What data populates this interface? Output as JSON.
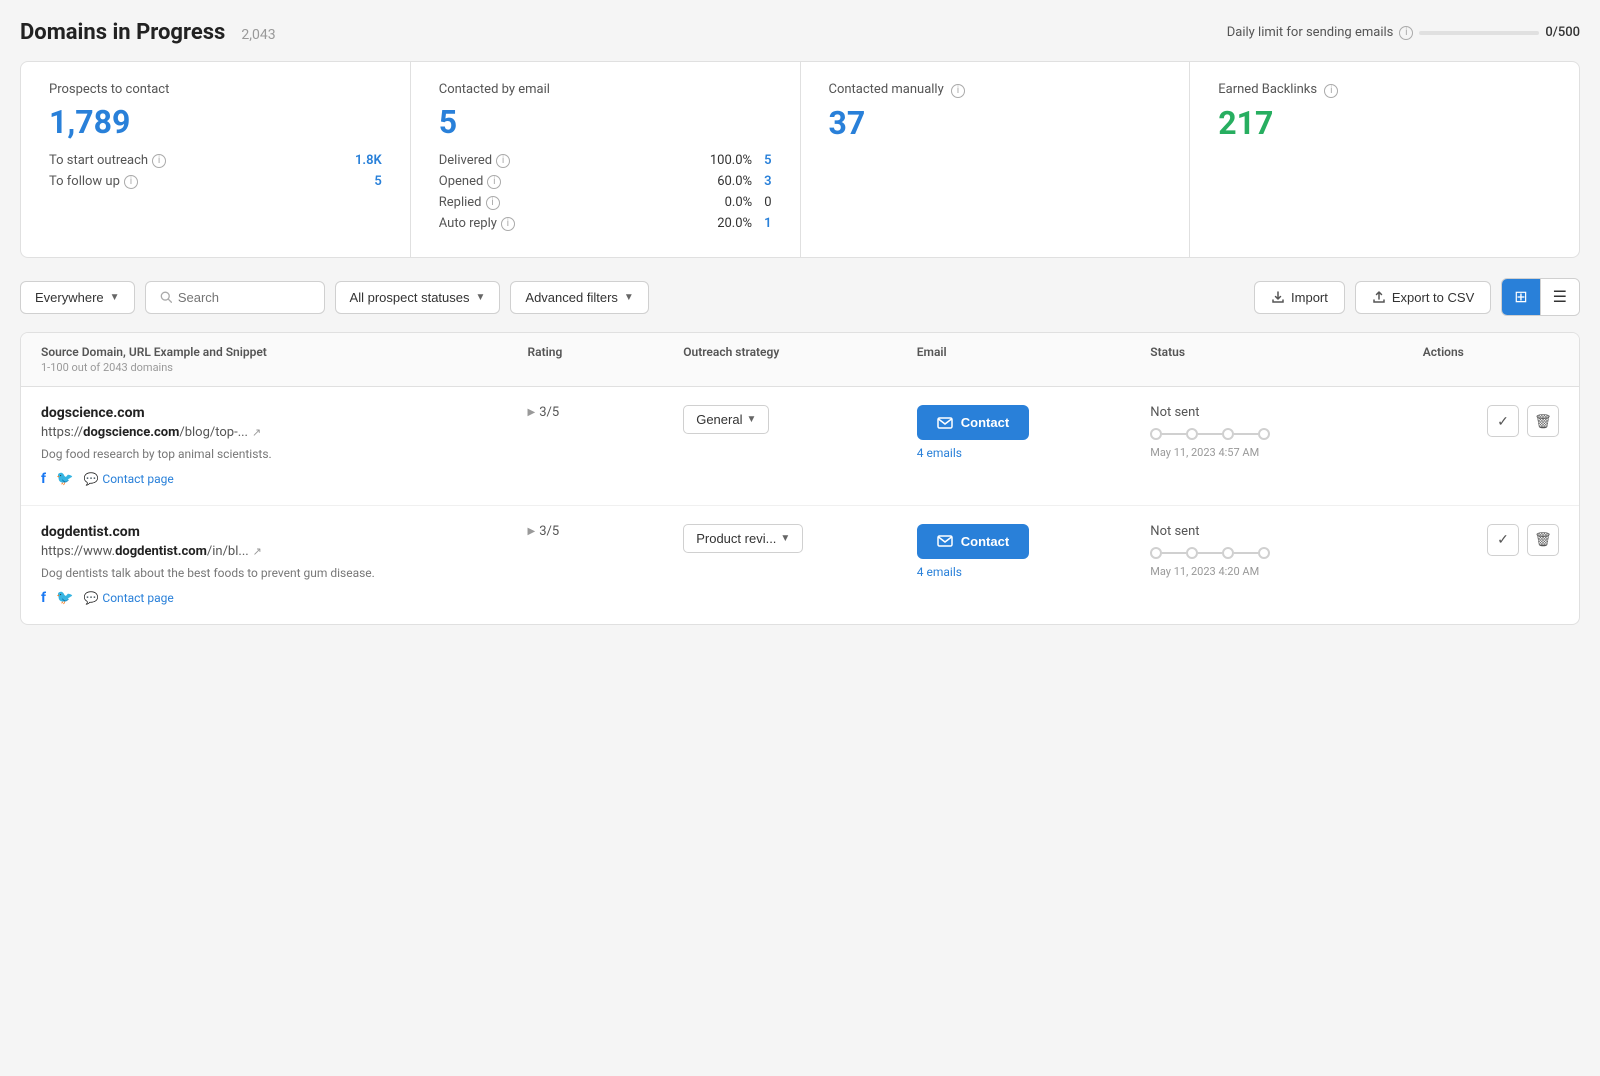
{
  "header": {
    "title": "Domains in Progress",
    "count": "2,043",
    "daily_limit_label": "Daily limit for sending emails",
    "daily_limit_value": "0/500",
    "info": "i"
  },
  "stats": {
    "prospects": {
      "label": "Prospects to contact",
      "value": "1,789",
      "rows": [
        {
          "label": "To start outreach",
          "pct": "",
          "count": "1.8K"
        },
        {
          "label": "To follow up",
          "pct": "",
          "count": "5"
        }
      ]
    },
    "email": {
      "label": "Contacted by email",
      "value": "5",
      "rows": [
        {
          "label": "Delivered",
          "pct": "100.0%",
          "count": "5"
        },
        {
          "label": "Opened",
          "pct": "60.0%",
          "count": "3"
        },
        {
          "label": "Replied",
          "pct": "0.0%",
          "count": "0"
        },
        {
          "label": "Auto reply",
          "pct": "20.0%",
          "count": "1"
        }
      ]
    },
    "manual": {
      "label": "Contacted manually",
      "value": "37"
    },
    "backlinks": {
      "label": "Earned Backlinks",
      "value": "217"
    }
  },
  "filters": {
    "everywhere_label": "Everywhere",
    "search_placeholder": "Search",
    "status_label": "All prospect statuses",
    "advanced_label": "Advanced filters",
    "import_label": "Import",
    "export_label": "Export to CSV"
  },
  "table": {
    "columns": [
      "Source Domain, URL Example and Snippet",
      "Rating",
      "Outreach strategy",
      "Email",
      "Status",
      "Actions"
    ],
    "subtitle": "1-100 out of 2043 domains",
    "rows": [
      {
        "domain": "dogscience.com",
        "url": "https://dogscience.com/blog/top-...",
        "url_bold": "dogscience.com",
        "description": "Dog food research by top animal scientists.",
        "rating": "3/5",
        "outreach": "General",
        "emails_count": "4 emails",
        "status_label": "Not sent",
        "status_date": "May 11, 2023 4:57 AM",
        "pipeline_dots": [
          false,
          false,
          false,
          false
        ]
      },
      {
        "domain": "dogdentist.com",
        "url": "https://www.dogdentist.com/in/bl...",
        "url_bold": "dogdentist.com",
        "description": "Dog dentists talk about the best foods to prevent gum disease.",
        "rating": "3/5",
        "outreach": "Product revi...",
        "emails_count": "4 emails",
        "status_label": "Not sent",
        "status_date": "May 11, 2023 4:20 AM",
        "pipeline_dots": [
          false,
          false,
          false,
          false
        ]
      }
    ]
  }
}
